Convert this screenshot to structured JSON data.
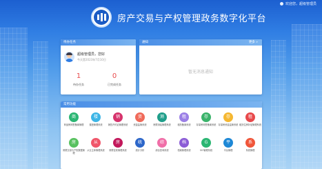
{
  "header": {
    "title": "房产交易与产权管理政务数字化平台",
    "user_text": "欢迎您，超级管理员"
  },
  "tasks_panel": {
    "title": "待办任务",
    "greeting": "超级管理员，您好",
    "date": "今天是2023年7月10日",
    "stats": [
      {
        "value": "1",
        "label": "待办任务"
      },
      {
        "value": "0",
        "label": "已完成任务"
      }
    ]
  },
  "notice_panel": {
    "title": "通知",
    "more": "更多 »",
    "empty": "暂无消息通知"
  },
  "functions_panel": {
    "title": "常用功能",
    "apps": [
      {
        "glyph": "商",
        "color": "#2bb673",
        "label": "商品房网签备案管理"
      },
      {
        "glyph": "楼",
        "color": "#3db5e6",
        "label": "楼盘管理系统"
      },
      {
        "glyph": "销",
        "color": "#d6336c",
        "label": "销售许可证管理系统"
      },
      {
        "glyph": "资",
        "color": "#f06a5a",
        "label": "资金监管系统"
      },
      {
        "glyph": "测",
        "color": "#1f9e8a",
        "label": "房屋测绘管理系统"
      },
      {
        "glyph": "租",
        "color": "#9b7fe6",
        "label": "租赁备案系统"
      },
      {
        "glyph": "存",
        "color": "#3bb36b",
        "label": "存量房网签备案系统"
      },
      {
        "glyph": "存",
        "color": "#f5b731",
        "label": "存量房资金监管系统"
      },
      {
        "glyph": "租",
        "color": "#e8494b",
        "label": "租赁住房补贴管理系统"
      },
      {
        "glyph": "房",
        "color": "#58c15f",
        "label": "房屋交易与产权数据管理"
      },
      {
        "glyph": "从",
        "color": "#f0566a",
        "label": "从业主体管理系统"
      },
      {
        "glyph": "房",
        "color": "#c2185b",
        "label": "房屋征收管理系统"
      },
      {
        "glyph": "统",
        "color": "#2c66c9",
        "label": "统计分析"
      },
      {
        "glyph": "综",
        "color": "#f06fa8",
        "label": "综合查询系统"
      },
      {
        "glyph": "档",
        "color": "#8b5cd6",
        "label": "档案管理系统"
      },
      {
        "glyph": "G",
        "color": "#2bb673",
        "label": "GIS管理系统"
      },
      {
        "glyph": "平",
        "color": "#1e88d6",
        "label": "平台管理"
      },
      {
        "glyph": "系",
        "color": "#f0563a",
        "label": "系统管理"
      }
    ]
  }
}
